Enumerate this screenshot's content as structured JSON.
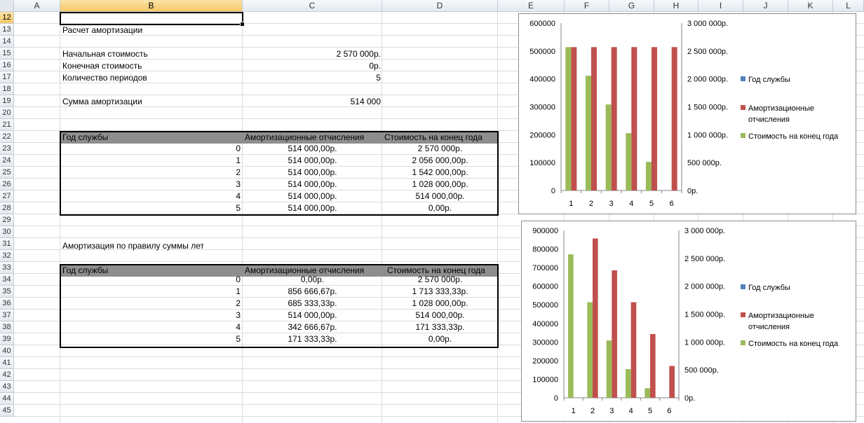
{
  "columns": [
    "A",
    "B",
    "C",
    "D",
    "E",
    "F",
    "G",
    "H",
    "I",
    "J",
    "K",
    "L"
  ],
  "rows": [
    "12",
    "13",
    "14",
    "15",
    "16",
    "17",
    "18",
    "19",
    "20",
    "21",
    "22",
    "23",
    "24",
    "25",
    "26",
    "27",
    "28",
    "29",
    "30",
    "31",
    "32",
    "33",
    "34",
    "35",
    "36",
    "37",
    "38",
    "39",
    "40",
    "41",
    "42",
    "43",
    "44",
    "45"
  ],
  "active_cell": "B12",
  "section1": {
    "title": "Расчет амортизации",
    "initial_cost_label": "Начальная стоимость",
    "initial_cost_value": "2 570 000р.",
    "final_cost_label": "Конечная стоимость",
    "final_cost_value": "0р.",
    "periods_label": "Количество периодов",
    "periods_value": "5",
    "amort_sum_label": "Сумма амортизации",
    "amort_sum_value": "514 000"
  },
  "table1": {
    "headers": [
      "Год службы",
      "Амортизационные отчисления",
      "Стоимость на конец года"
    ],
    "rows": [
      [
        "0",
        "514 000,00р.",
        "2 570 000р."
      ],
      [
        "1",
        "514 000,00р.",
        "2 056 000,00р."
      ],
      [
        "2",
        "514 000,00р.",
        "1 542 000,00р."
      ],
      [
        "3",
        "514 000,00р.",
        "1 028 000,00р."
      ],
      [
        "4",
        "514 000,00р.",
        "514 000,00р."
      ],
      [
        "5",
        "514 000,00р.",
        "0,00р."
      ]
    ]
  },
  "section2": {
    "title": "Амортизация по правилу суммы лет"
  },
  "table2": {
    "headers": [
      "Год службы",
      "Амортизационные отчисления",
      "Стоимость на конец года"
    ],
    "rows": [
      [
        "0",
        "0,00р.",
        "2 570 000р."
      ],
      [
        "1",
        "856 666,67р.",
        "1 713 333,33р."
      ],
      [
        "2",
        "685 333,33р.",
        "1 028 000,00р."
      ],
      [
        "3",
        "514 000,00р.",
        "514 000,00р."
      ],
      [
        "4",
        "342 666,67р.",
        "171 333,33р."
      ],
      [
        "5",
        "171 333,33р.",
        "0,00р."
      ]
    ]
  },
  "colors": {
    "series_year": "#4f81bd",
    "series_amort": "#c0504d",
    "series_cost": "#9bbb59",
    "table_header": "#8e8e8e",
    "selection": "#f5c865"
  },
  "chart_data": [
    {
      "type": "bar",
      "categories": [
        "1",
        "2",
        "3",
        "4",
        "5",
        "6"
      ],
      "series": [
        {
          "name": "Год службы",
          "values": [
            0,
            1,
            2,
            3,
            4,
            5
          ],
          "axis": "primary"
        },
        {
          "name": "Амортизационные отчисления",
          "values": [
            514000,
            514000,
            514000,
            514000,
            514000,
            514000
          ],
          "axis": "primary"
        },
        {
          "name": "Стоимость на конец года",
          "values": [
            2570000,
            2056000,
            1542000,
            1028000,
            514000,
            0
          ],
          "axis": "secondary"
        }
      ],
      "y_ticks": [
        "0",
        "100000",
        "200000",
        "300000",
        "400000",
        "500000",
        "600000"
      ],
      "ylim": [
        0,
        600000
      ],
      "y2_ticks": [
        "0р.",
        "500 000р.",
        "1 000 000р.",
        "1 500 000р.",
        "2 000 000р.",
        "2 500 000р.",
        "3 000 000р."
      ],
      "y2lim": [
        0,
        3000000
      ],
      "legend": "right"
    },
    {
      "type": "bar",
      "categories": [
        "1",
        "2",
        "3",
        "4",
        "5",
        "6"
      ],
      "series": [
        {
          "name": "Год службы",
          "values": [
            0,
            1,
            2,
            3,
            4,
            5
          ],
          "axis": "primary"
        },
        {
          "name": "Амортизационные отчисления",
          "values": [
            0,
            856666.67,
            685333.33,
            514000,
            342666.67,
            171333.33
          ],
          "axis": "primary"
        },
        {
          "name": "Стоимость на конец года",
          "values": [
            2570000,
            1713333.33,
            1028000,
            514000,
            171333.33,
            0
          ],
          "axis": "secondary"
        }
      ],
      "y_ticks": [
        "0",
        "100000",
        "200000",
        "300000",
        "400000",
        "500000",
        "600000",
        "700000",
        "800000",
        "900000"
      ],
      "ylim": [
        0,
        900000
      ],
      "y2_ticks": [
        "0р.",
        "500 000р.",
        "1 000 000р.",
        "1 500 000р.",
        "2 000 000р.",
        "2 500 000р.",
        "3 000 000р."
      ],
      "y2lim": [
        0,
        3000000
      ],
      "legend": "right"
    }
  ]
}
